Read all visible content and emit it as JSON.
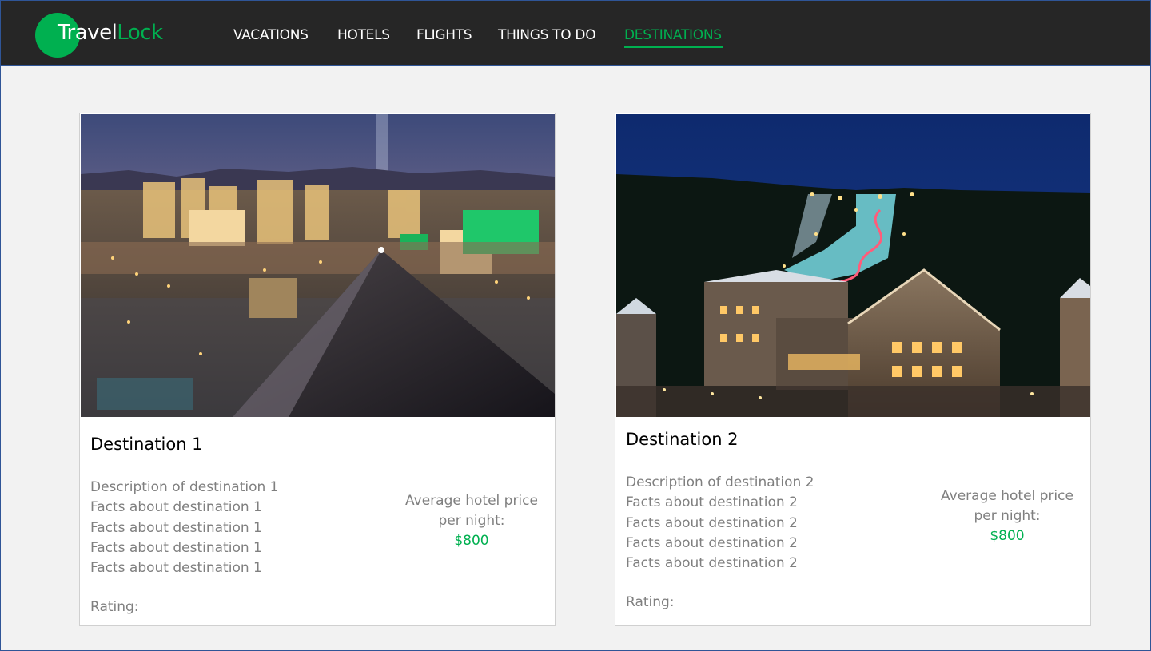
{
  "brand": {
    "name_part1": "Travel",
    "name_part2": "Lock"
  },
  "nav": {
    "items": [
      {
        "label": "VACATIONS"
      },
      {
        "label": "HOTELS"
      },
      {
        "label": "FLIGHTS"
      },
      {
        "label": "THINGS TO DO"
      },
      {
        "label": "DESTINATIONS",
        "active": true
      }
    ]
  },
  "colors": {
    "accent": "#00b050",
    "navbar_bg": "#262626",
    "page_bg": "#f2f2f2",
    "muted_text": "#7f7f7f"
  },
  "destinations": [
    {
      "title": "Destination 1",
      "description": "Description of destination 1",
      "facts": [
        "Facts about destination 1",
        "Facts about destination 1",
        "Facts about destination 1",
        "Facts about destination 1"
      ],
      "price_label_line1": "Average hotel price",
      "price_label_line2": "per night:",
      "price": "$800",
      "rating_label": "Rating:",
      "image_subject": "city-skyline-at-night"
    },
    {
      "title": "Destination 2",
      "description": "Description of destination 2",
      "facts": [
        "Facts about destination 2",
        "Facts about destination 2",
        "Facts about destination 2",
        "Facts about destination 2"
      ],
      "price_label_line1": "Average hotel price",
      "price_label_line2": "per night:",
      "price": "$800",
      "rating_label": "Rating:",
      "image_subject": "ski-resort-village-at-night"
    }
  ]
}
